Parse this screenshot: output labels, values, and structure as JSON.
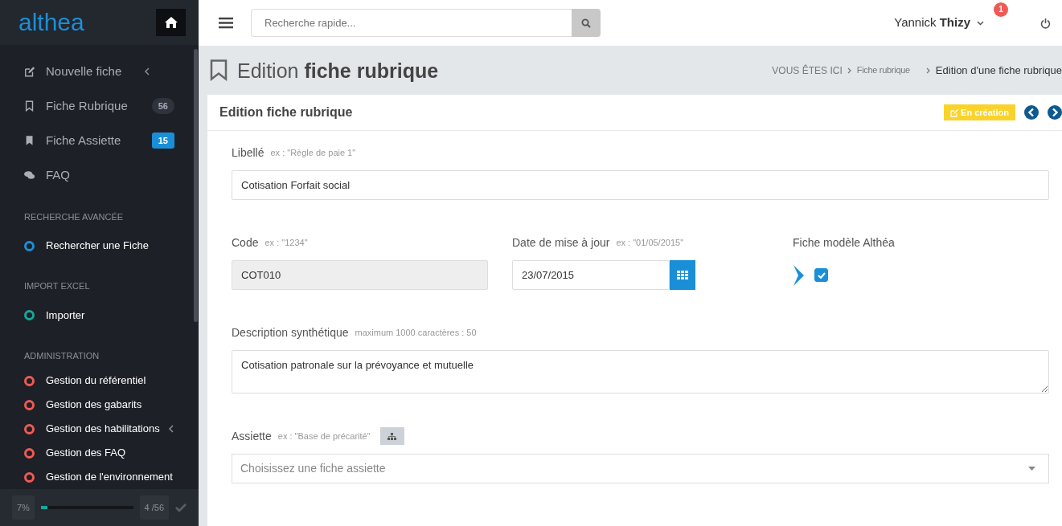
{
  "logo": "althea",
  "sidebar": {
    "items": [
      {
        "label": "Nouvelle fiche",
        "kind": "edit",
        "expandable": true
      },
      {
        "label": "Fiche Rubrique",
        "kind": "bookmark-outline",
        "expandable": false,
        "badge": "56",
        "color": "#2f343c"
      },
      {
        "label": "Fiche Assiette",
        "kind": "bookmark",
        "expandable": false,
        "badge": "15",
        "color": "#1a8fd8"
      },
      {
        "label": "FAQ",
        "kind": "comments",
        "expandable": false
      }
    ],
    "sections": [
      {
        "title": "RECHERCHE AVANCÉE",
        "items": [
          {
            "label": "Rechercher une Fiche",
            "color": "#1a8fd8",
            "expandable": false
          }
        ]
      },
      {
        "title": "IMPORT EXCEL",
        "items": [
          {
            "label": "Importer",
            "color": "#16a89a",
            "expandable": false
          }
        ]
      },
      {
        "title": "ADMINISTRATION",
        "items": [
          {
            "label": "Gestion du référentiel",
            "color": "#f05a55",
            "expandable": false
          },
          {
            "label": "Gestion des gabarits",
            "color": "#f05a55",
            "expandable": false
          },
          {
            "label": "Gestion des habilitations",
            "color": "#f05a55",
            "expandable": true
          },
          {
            "label": "Gestion des FAQ",
            "color": "#f05a55",
            "expandable": false
          },
          {
            "label": "Gestion de l'environnement",
            "color": "#f05a55",
            "expandable": false
          }
        ]
      }
    ],
    "progress": {
      "percent": "7%",
      "level": 0.07,
      "count": "4 /56"
    }
  },
  "topbar": {
    "search_placeholder": "Recherche rapide...",
    "user_first": "Yannick",
    "user_last": "Thizy",
    "notifications": "1"
  },
  "page_title": "Edition **fiche rubrique**",
  "breadcrumb": [
    "VOUS ÊTES ICI",
    "Fiche rubrique",
    "Edition d'une fiche rubrique"
  ],
  "card": {
    "title": "Edition fiche rubrique",
    "status": "En création",
    "fields": {
      "libelle": {
        "label": "Libellé",
        "hint": "ex : \"Règle de paie 1\"",
        "value": "Cotisation Forfait social"
      },
      "code": {
        "label": "Code",
        "hint": "ex : \"1234\"",
        "value": "COT010",
        "disabled": true
      },
      "date": {
        "label": "Date de mise à jour",
        "hint": "ex : \"01/05/2015\"",
        "value": "23/07/2015"
      },
      "modele": {
        "label": "Fiche modèle Althéa",
        "checked": true
      },
      "description": {
        "label": "Description synthétique",
        "hint": "maximum 1000 caractères : 50",
        "value": "Cotisation patronale sur la prévoyance et mutuelle"
      },
      "assiette": {
        "label": "Assiette",
        "hint": "ex : \"Base de précarité\"",
        "placeholder": "Choisissez une fiche assiette"
      }
    }
  }
}
